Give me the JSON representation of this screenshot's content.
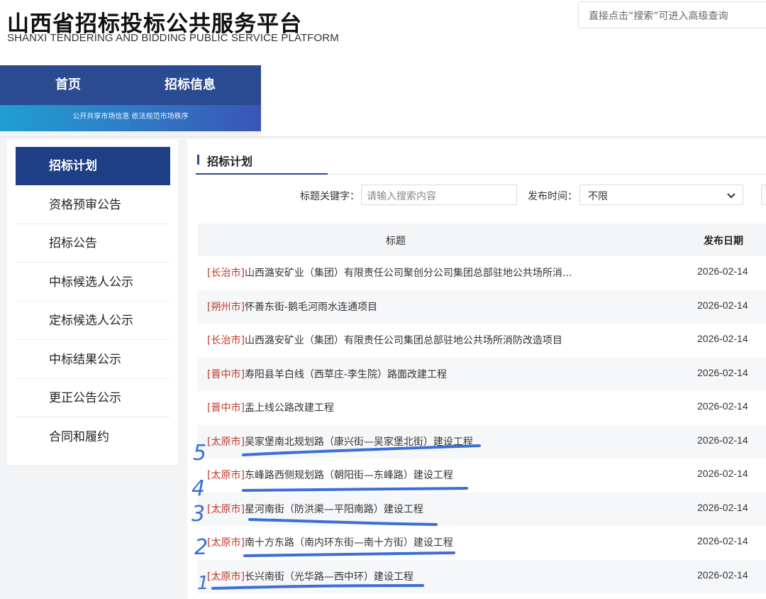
{
  "header": {
    "title": "山西省招标投标公共服务平台",
    "subtitle": "SHANXI TENDERING AND BIDDING PUBLIC SERVICE PLATFORM",
    "search_placeholder": "直接点击“搜索”可进入高级查询"
  },
  "nav": {
    "items": [
      "首页",
      "招标信息"
    ]
  },
  "banner": {
    "text": "公开共享市场信息  依法规范市场秩序",
    "small_text": "· · ·"
  },
  "sidebar": {
    "items": [
      {
        "label": "招标计划",
        "active": true
      },
      {
        "label": "资格预审公告"
      },
      {
        "label": "招标公告"
      },
      {
        "label": "中标候选人公示"
      },
      {
        "label": "定标候选人公示"
      },
      {
        "label": "中标结果公示"
      },
      {
        "label": "更正公告公示"
      },
      {
        "label": "合同和履约"
      }
    ]
  },
  "main": {
    "section_title": "招标计划",
    "filters": {
      "keyword_label": "标题关键字：",
      "keyword_placeholder": "请输入搜索内容",
      "date_label": "发布时间：",
      "date_value": "不限"
    },
    "table": {
      "columns": [
        "标题",
        "发布日期"
      ],
      "rows": [
        {
          "city": "[长治市]",
          "title": "山西潞安矿业（集团）有限责任公司聚创分公司集团总部驻地公共场所消...",
          "date": "2026-02-14"
        },
        {
          "city": "[朔州市]",
          "title": "怀善东街-鹅毛河雨水连通项目",
          "date": "2026-02-14"
        },
        {
          "city": "[长治市]",
          "title": "山西潞安矿业（集团）有限责任公司集团总部驻地公共场所消防改造项目",
          "date": "2026-02-14"
        },
        {
          "city": "[晋中市]",
          "title": "寿阳县羊白线（西草庄-李生院）路面改建工程",
          "date": "2026-02-14"
        },
        {
          "city": "[晋中市]",
          "title": "盂上线公路改建工程",
          "date": "2026-02-14"
        },
        {
          "city": "[太原市]",
          "title": "吴家堡南北规划路（康兴街—吴家堡北街）建设工程",
          "date": "2026-02-14"
        },
        {
          "city": "[太原市]",
          "title": "东峰路西侧规划路（朝阳街—东峰路）建设工程",
          "date": "2026-02-14"
        },
        {
          "city": "[太原市]",
          "title": "星河南街（防洪渠—平阳南路）建设工程",
          "date": "2026-02-14"
        },
        {
          "city": "[太原市]",
          "title": "南十方东路（南内环东街—南十方街）建设工程",
          "date": "2026-02-14"
        },
        {
          "city": "[太原市]",
          "title": "长兴南街（光华路—西中环）建设工程",
          "date": "2026-02-14"
        }
      ]
    }
  },
  "annotations": {
    "numbers": [
      "5",
      "4",
      "3",
      "2",
      "1"
    ],
    "ink_color": "#3b6fd8"
  }
}
